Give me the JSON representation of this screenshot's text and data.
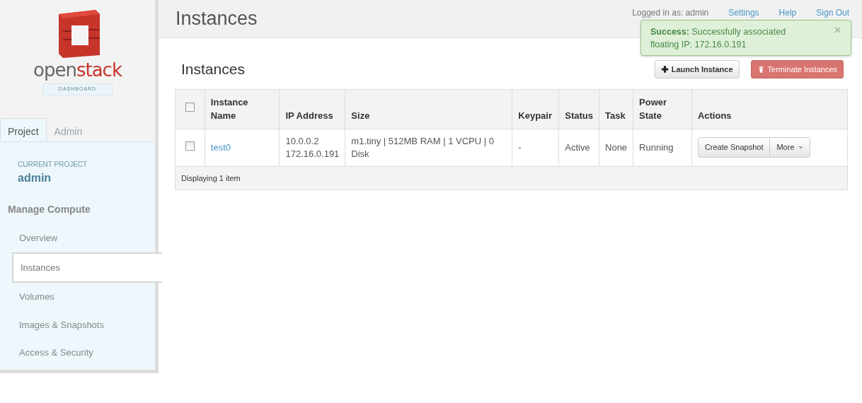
{
  "logo": {
    "text_dark": "open",
    "text_accent": "stack",
    "tagline": "DASHBOARD"
  },
  "dashboard_tabs": [
    {
      "label": "Project",
      "selected": true
    },
    {
      "label": "Admin",
      "selected": false
    }
  ],
  "current_project": {
    "caption": "CURRENT PROJECT",
    "name": "admin"
  },
  "sidebar": {
    "heading": "Manage Compute",
    "items": [
      {
        "label": "Overview",
        "selected": false
      },
      {
        "label": "Instances",
        "selected": true
      },
      {
        "label": "Volumes",
        "selected": false
      },
      {
        "label": "Images & Snapshots",
        "selected": false
      },
      {
        "label": "Access & Security",
        "selected": false
      }
    ]
  },
  "header": {
    "title": "Instances",
    "user_text": "Logged in as: admin",
    "links": [
      "Settings",
      "Help",
      "Sign Out"
    ]
  },
  "alert": {
    "message": "**Success:** Successfully associated floating IP: 172.16.0.191",
    "close": "×"
  },
  "page": {
    "title": "Instances",
    "buttons": [
      {
        "label": "Launch Instance",
        "kind": "add"
      },
      {
        "label": "Terminate Instances",
        "kind": "danger"
      }
    ]
  },
  "table": {
    "columns": [
      "Instance Name",
      "IP Address",
      "Size",
      "Keypair",
      "Status",
      "Task",
      "Power State",
      "Actions"
    ],
    "rows": [
      {
        "checked": false,
        "name": "test0",
        "ip_lines": [
          "10.0.0.2",
          "172.16.0.191"
        ],
        "size": "m1.tiny | 512MB RAM | 1 VCPU | 0 Disk",
        "keypair": "-",
        "status": "Active",
        "task": "None",
        "power_state": "Running",
        "action": "Create Snapshot",
        "more": "More"
      }
    ],
    "header_checked": false,
    "footer": "Displaying 1 item"
  }
}
